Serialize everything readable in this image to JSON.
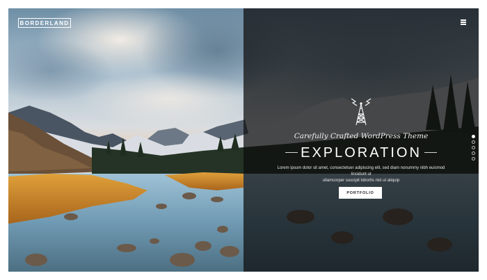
{
  "header": {
    "logo_text": "BORDERLAND",
    "menu_icon": "hamburger-icon"
  },
  "hero": {
    "icon": "radio-tower-icon",
    "tagline": "Carefully Crafted WordPress Theme",
    "title": "EXPLORATION",
    "description_line1": "Lorem ipsum dolor sit amet, consectetuer adipiscing elit, sed diam nonummy nibh euismod tincidunt ut",
    "description_line2": "ullamcorper suscipit lobortis nisl ut aliquip",
    "cta_label": "PORTFOLIO"
  },
  "slider": {
    "dot_count": 5,
    "active_index": 0
  },
  "colors": {
    "overlay": "#0c0c0c",
    "accent_sky": "#f2b27a",
    "grass": "#d08a2a"
  }
}
